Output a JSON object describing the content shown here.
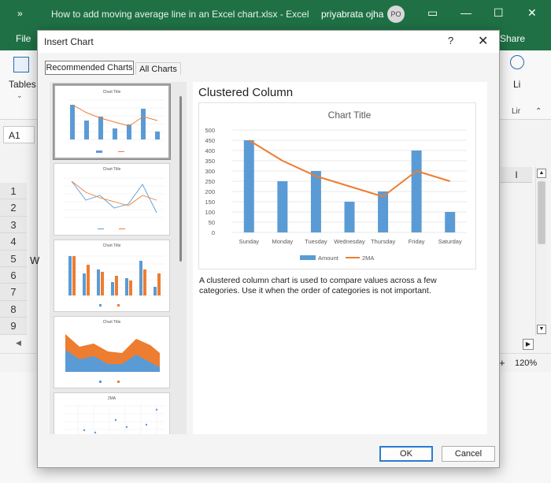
{
  "excel": {
    "quick_access": "»",
    "doc_title": "How to add moving average line in an Excel chart.xlsx  -  Excel",
    "user": "priyabrata ojha",
    "avatar": "PO",
    "file": "File",
    "share": "Share",
    "tables": "Tables",
    "link_partial": "Li",
    "group_partial": "Lir",
    "namebox": "A1",
    "rows": [
      "1",
      "2",
      "3",
      "4",
      "5",
      "6",
      "7",
      "8",
      "9"
    ],
    "row5_cell": "W",
    "col_header": "I",
    "zoom": "120%",
    "zoom_plus": "+"
  },
  "dialog": {
    "title": "Insert Chart",
    "help": "?",
    "close": "✕",
    "tabs": [
      "Recommended Charts",
      "All Charts"
    ],
    "preview_title": "Clustered Column",
    "description": "A clustered column chart is used to compare values across a few categories. Use it when the order of categories is not important.",
    "ok": "OK",
    "cancel": "Cancel",
    "thumb_titles": [
      "Chart Title",
      "Chart Title",
      "Chart Title",
      "Chart Title",
      "2MA"
    ]
  },
  "chart_data": {
    "type": "bar",
    "title": "Chart Title",
    "categories": [
      "Sunday",
      "Monday",
      "Tuesday",
      "Wednesday",
      "Thursday",
      "Friday",
      "Saturday"
    ],
    "series": [
      {
        "name": "Amount",
        "type": "bar",
        "color": "#5b9bd5",
        "values": [
          450,
          250,
          300,
          150,
          200,
          400,
          100
        ]
      },
      {
        "name": "2MA",
        "type": "line",
        "color": "#ed7d31",
        "values": [
          450,
          350,
          275,
          225,
          175,
          300,
          250
        ]
      }
    ],
    "ylim": [
      0,
      500
    ],
    "yticks": [
      0,
      50,
      100,
      150,
      200,
      250,
      300,
      350,
      400,
      450,
      500
    ],
    "legend": "bottom",
    "grid": true
  },
  "colors": {
    "excel_green": "#1f7145",
    "bar_blue": "#5b9bd5",
    "line_orange": "#ed7d31"
  }
}
